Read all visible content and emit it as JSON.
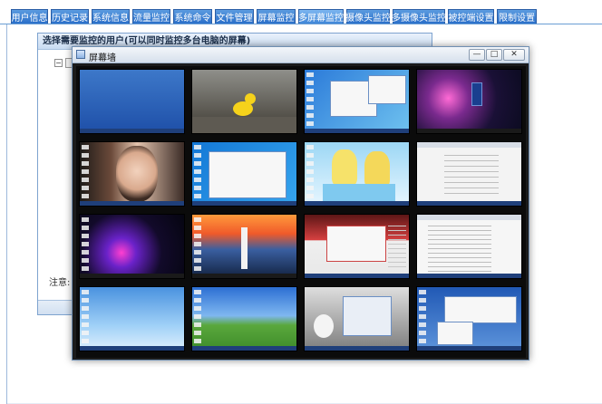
{
  "tabs": [
    {
      "label": "用户信息",
      "active": false
    },
    {
      "label": "历史记录",
      "active": false
    },
    {
      "label": "系统信息",
      "active": false
    },
    {
      "label": "流量监控",
      "active": false
    },
    {
      "label": "系统命令",
      "active": false
    },
    {
      "label": "文件管理",
      "active": false
    },
    {
      "label": "屏幕监控",
      "active": false
    },
    {
      "label": "多屏幕监控",
      "active": true
    },
    {
      "label": "摄像头监控",
      "active": false
    },
    {
      "label": "多摄像头监控",
      "active": false
    },
    {
      "label": "被控端设置",
      "active": false
    },
    {
      "label": "限制设置",
      "active": false
    }
  ],
  "user_dialog": {
    "title": "选择需要监控的用户(可以同时监控多台电脑的屏幕)",
    "tree_toggle": "−",
    "note_label": "注意:"
  },
  "screen_wall": {
    "title": "屏幕墙",
    "minimize": "—",
    "maximize": "□",
    "close": "✕",
    "tiles": [
      "Windows 7 blue desktop",
      "rubber duck wallpaper",
      "Windows 7 with open windows",
      "space nebula wallpaper with blue box",
      "portrait wallpaper desktop",
      "Windows 7 explorer window",
      "anime characters wallpaper",
      "white document window",
      "purple light-wave wallpaper",
      "lighthouse sunset wallpaper",
      "web browser window",
      "document text window",
      "Windows XP blue sky desktop",
      "Windows XP Bliss desktop",
      "gray photo with dialog",
      "Windows XP blue desktop with windows"
    ]
  },
  "colors": {
    "tab_blue": "#2a6fc9",
    "dialog_title_bg": "#c9dcf2",
    "wall_background": "#1b1b1b"
  }
}
